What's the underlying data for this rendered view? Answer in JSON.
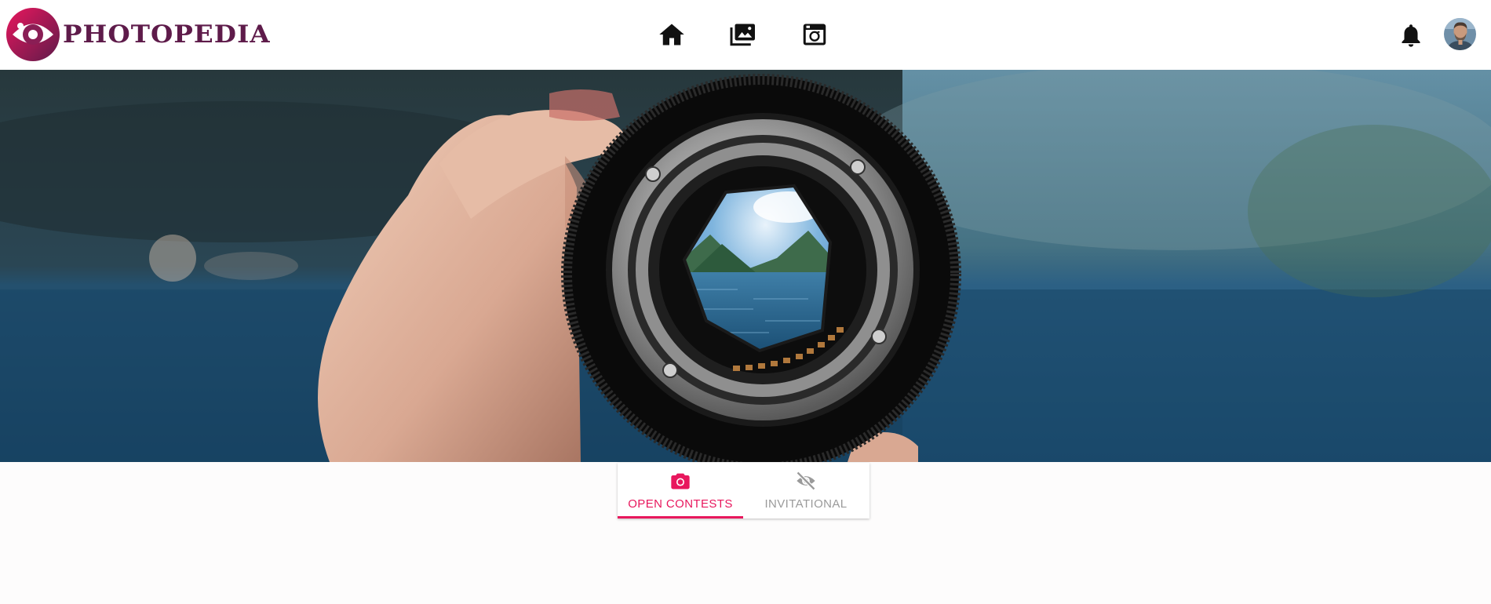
{
  "app": {
    "name": "PHOTOPEDIA",
    "brand_color": "#5e1b4a",
    "logo_gradient": [
      "#e8175d",
      "#5e1b4a"
    ]
  },
  "nav": {
    "items": [
      {
        "id": "home",
        "icon": "home-icon"
      },
      {
        "id": "gallery",
        "icon": "image-gallery-icon"
      },
      {
        "id": "contests",
        "icon": "camera-box-icon"
      }
    ]
  },
  "header_actions": {
    "notifications_icon": "bell-icon",
    "avatar_icon": "user-avatar"
  },
  "hero": {
    "image_subject": "hand-holding-camera-lens-icon"
  },
  "tabs": {
    "accent_color": "#e8175d",
    "items": [
      {
        "label": "OPEN CONTESTS",
        "icon": "camera-icon",
        "active": true
      },
      {
        "label": "INVITATIONAL",
        "icon": "eye-off-icon",
        "active": false
      }
    ]
  }
}
